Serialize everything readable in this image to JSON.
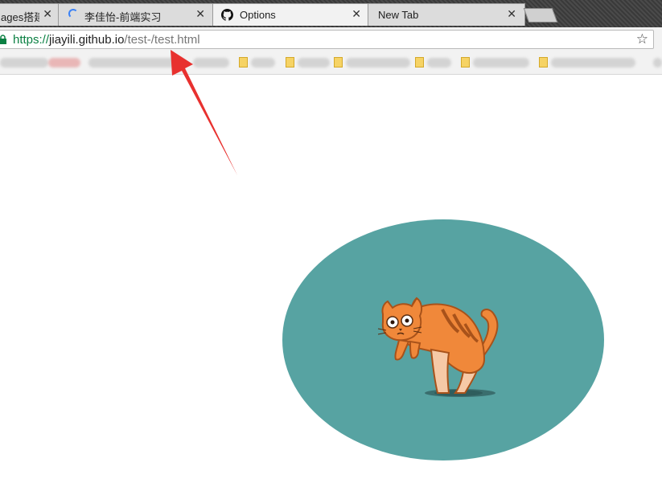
{
  "tabs": [
    {
      "label": "ages搭建",
      "active": false
    },
    {
      "label": "李佳怡-前端实习",
      "active": false,
      "loading": true
    },
    {
      "label": "Options",
      "active": true,
      "icon": "github-icon"
    },
    {
      "label": "New Tab",
      "active": false
    }
  ],
  "close_glyph": "✕",
  "omnibox": {
    "scheme": "https://",
    "host": "jiayili.github.io",
    "path": "/test-/test.html",
    "star_glyph": "☆"
  },
  "colors": {
    "ellipse": "#57a3a2",
    "cat_body": "#f0883a",
    "arrow": "#e8312f",
    "secure_green": "#0b8043"
  },
  "icons": [
    "lock-icon",
    "github-icon",
    "loading-spinner-icon",
    "star-icon",
    "close-icon",
    "cat-illustration",
    "red-arrow"
  ]
}
